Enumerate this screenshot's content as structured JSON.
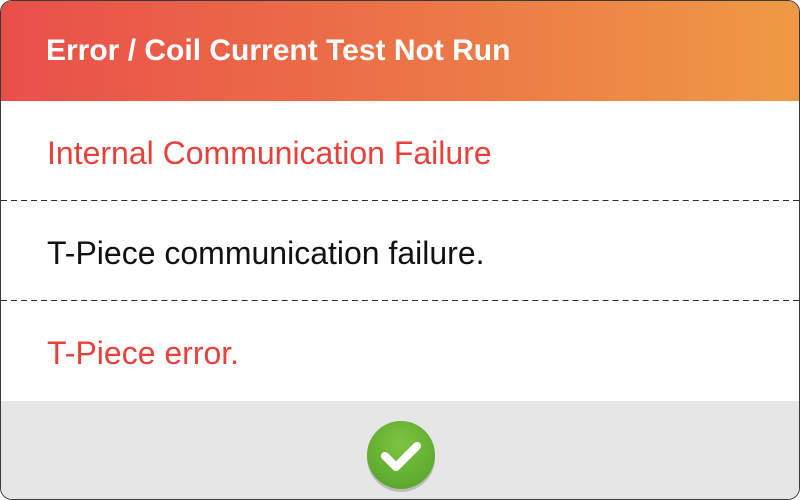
{
  "dialog": {
    "title": "Error / Coil Current Test Not Run",
    "error_category": "Internal Communication Failure",
    "error_description": "T-Piece communication failure.",
    "error_detail": "T-Piece error.",
    "confirm_icon": "checkmark-icon"
  },
  "colors": {
    "header_gradient_start": "#e94f4a",
    "header_gradient_end": "#ee9a44",
    "error_text": "#e8413b",
    "confirm_button": "#6cb535",
    "footer_background": "#e6e6e6"
  }
}
